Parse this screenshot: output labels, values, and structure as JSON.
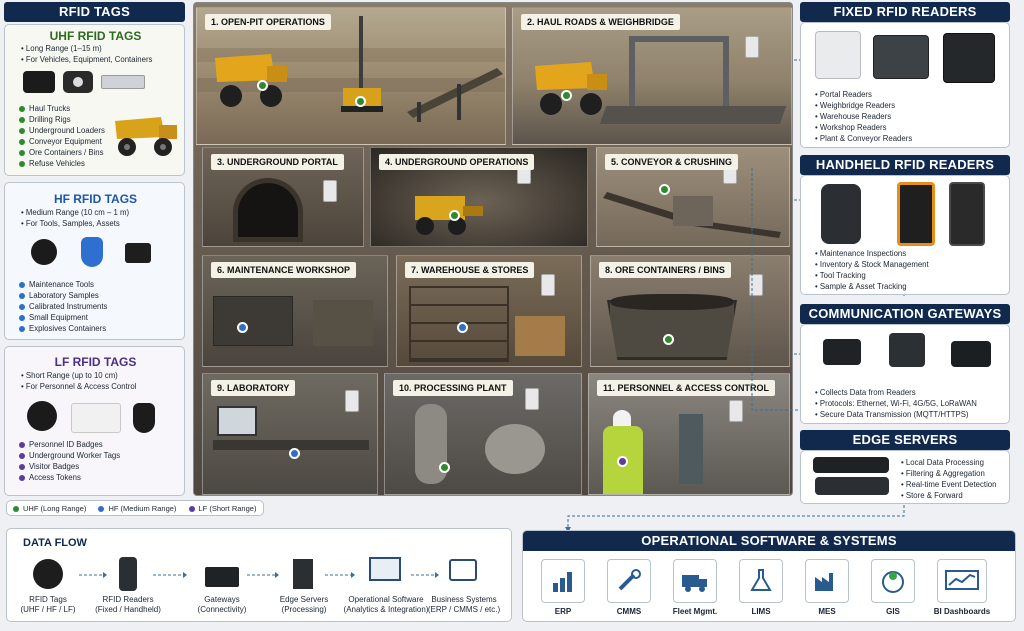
{
  "rfid_tags": {
    "title": "RFID TAGS",
    "uhf": {
      "title": "UHF RFID TAGS",
      "range": "Long Range (1–15 m)",
      "use": "For Vehicles, Equipment, Containers",
      "items": [
        "Haul Trucks",
        "Drilling Rigs",
        "Underground Loaders",
        "Conveyor Equipment",
        "Ore Containers / Bins",
        "Refuse Vehicles"
      ]
    },
    "hf": {
      "title": "HF RFID TAGS",
      "range": "Medium Range (10 cm – 1 m)",
      "use": "For Tools, Samples, Assets",
      "items": [
        "Maintenance Tools",
        "Laboratory Samples",
        "Calibrated Instruments",
        "Small Equipment",
        "Explosives Containers"
      ]
    },
    "lf": {
      "title": "LF RFID TAGS",
      "range": "Short Range (up to 10 cm)",
      "use": "For Personnel & Access Control",
      "items": [
        "Personnel ID Badges",
        "Underground Worker Tags",
        "Visitor Badges",
        "Access Tokens"
      ]
    }
  },
  "legend": {
    "uhf": "UHF (Long Range)",
    "hf": "HF (Medium Range)",
    "lf": "LF (Short Range)"
  },
  "colors": {
    "uhf": "#2f8a2f",
    "hf": "#2e6fc7",
    "lf": "#5c3d9a",
    "navy": "#10294d"
  },
  "scenes": {
    "s1": "1. OPEN-PIT OPERATIONS",
    "s2": "2. HAUL ROADS & WEIGHBRIDGE",
    "s3": "3. UNDERGROUND PORTAL",
    "s4": "4. UNDERGROUND OPERATIONS",
    "s5": "5. CONVEYOR & CRUSHING",
    "s6": "6. MAINTENANCE WORKSHOP",
    "s7": "7. WAREHOUSE & STORES",
    "s8": "8. ORE CONTAINERS / BINS",
    "s9": "9. LABORATORY",
    "s10": "10. PROCESSING PLANT",
    "s11": "11. PERSONNEL & ACCESS CONTROL"
  },
  "fixed_readers": {
    "title": "FIXED RFID READERS",
    "items": [
      "Portal Readers",
      "Weighbridge Readers",
      "Warehouse Readers",
      "Workshop Readers",
      "Plant & Conveyor Readers"
    ]
  },
  "handheld_readers": {
    "title": "HANDHELD RFID READERS",
    "items": [
      "Maintenance Inspections",
      "Inventory & Stock Management",
      "Tool Tracking",
      "Sample & Asset Tracking"
    ]
  },
  "gateways": {
    "title": "COMMUNICATION GATEWAYS",
    "items": [
      "Collects Data from Readers",
      "Protocols: Ethernet, Wi-Fi, 4G/5G, LoRaWAN",
      "Secure Data Transmission (MQTT/HTTPS)"
    ]
  },
  "edge": {
    "title": "EDGE SERVERS",
    "items": [
      "Local Data Processing",
      "Filtering & Aggregation",
      "Real-time Event Detection",
      "Store & Forward"
    ]
  },
  "data_flow": {
    "title": "DATA FLOW",
    "steps": [
      {
        "name": "RFID Tags",
        "sub": "(UHF / HF / LF)"
      },
      {
        "name": "RFID Readers",
        "sub": "(Fixed / Handheld)"
      },
      {
        "name": "Gateways",
        "sub": "(Connectivity)"
      },
      {
        "name": "Edge Servers",
        "sub": "(Processing)"
      },
      {
        "name": "Operational Software",
        "sub": "(Analytics & Integration)"
      },
      {
        "name": "Business Systems",
        "sub": "(ERP / CMMS / etc.)"
      }
    ]
  },
  "software": {
    "title": "OPERATIONAL SOFTWARE & SYSTEMS",
    "systems": [
      "ERP",
      "CMMS",
      "Fleet Mgmt.",
      "LIMS",
      "MES",
      "GIS",
      "BI Dashboards"
    ]
  }
}
